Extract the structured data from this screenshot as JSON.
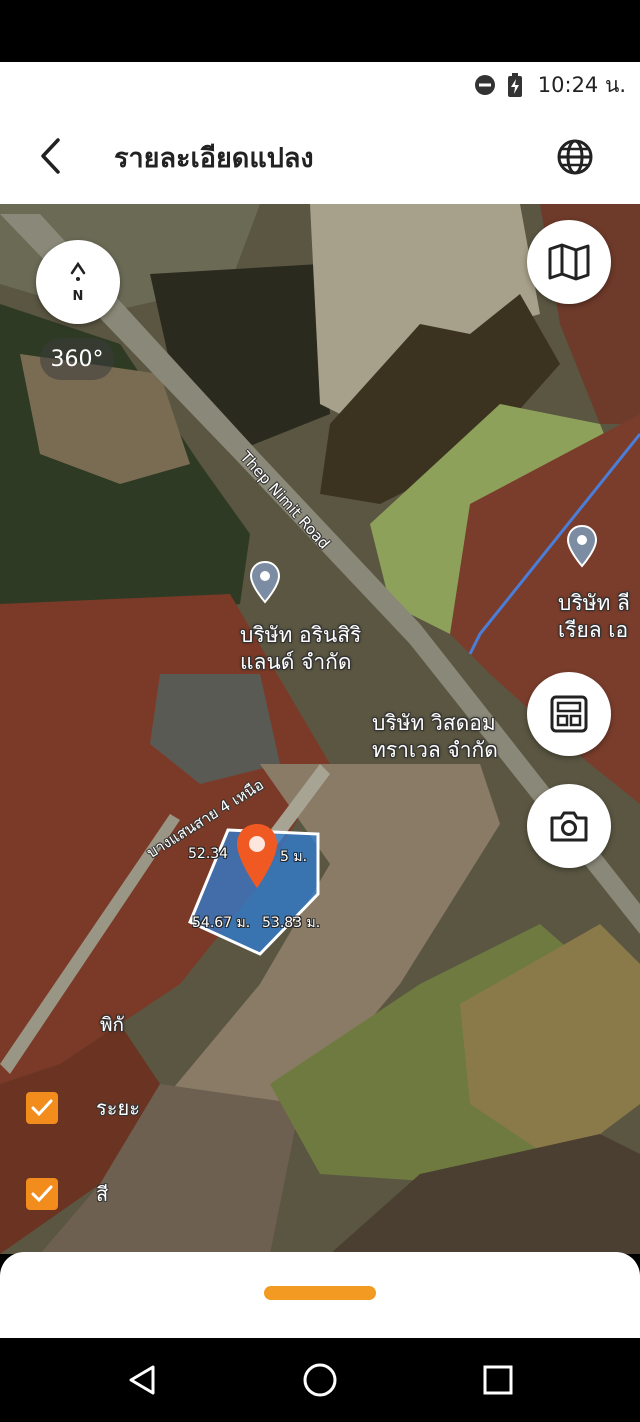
{
  "status_bar": {
    "time": "10:24 น."
  },
  "header": {
    "title": "รายละเอียดแปลง"
  },
  "map": {
    "compass_label": "N",
    "rotation_label": "360°",
    "road_label": "Thep Nimit Road",
    "soi_label": "บางแสนสาย 4 เหนือ",
    "poi_1": {
      "line1": "บริษัท อรินสิริ",
      "line2": "แลนด์ จำกัด"
    },
    "poi_2": {
      "line1": "บริษัท วิสดอม",
      "line2": "ทราเวล จำกัด"
    },
    "poi_3": {
      "line1": "บริษัท ลี",
      "line2": "เรียล เอ"
    },
    "dimensions": {
      "top_left": "52.34",
      "top_right": "5 ม.",
      "bottom_left": "54.67 ม.",
      "bottom_right": "53.83 ม."
    },
    "partial_label": "พิกั",
    "toggles": [
      {
        "label": "ระยะ",
        "checked": true
      },
      {
        "label": "สี",
        "checked": true
      }
    ]
  },
  "colors": {
    "accent": "#f28c1c",
    "parcel_fill": "#2f7fd6",
    "pin": "#f05a22"
  },
  "icons": [
    "back-arrow-icon",
    "globe-icon",
    "map-icon",
    "calculator-icon",
    "camera-icon",
    "compass-icon",
    "location-pin-icon",
    "check-icon",
    "nav-back-icon",
    "nav-home-icon",
    "nav-recents-icon"
  ]
}
